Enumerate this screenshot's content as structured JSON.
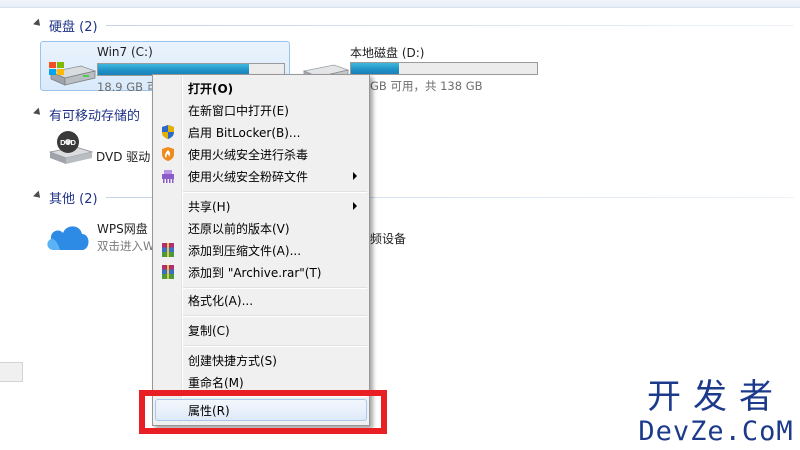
{
  "sections": {
    "hard_disks": {
      "title": "硬盘 (2)"
    },
    "removable": {
      "title": "有可移动存储的"
    },
    "other": {
      "title": "其他 (2)"
    }
  },
  "drives": {
    "c": {
      "name": "Win7 (C:)",
      "free_text": "18.9 GB 可",
      "used_fraction": 0.81
    },
    "d": {
      "name": "本地磁盘 (D:)",
      "free_text": "GB 可用，共 138 GB",
      "used_fraction": 0.26
    }
  },
  "dvd": {
    "name": "DVD 驱动",
    "badge": "DVD"
  },
  "wps": {
    "name": "WPS网盘",
    "sub": "双击进入W"
  },
  "video_device": {
    "name": "频设备"
  },
  "context_menu": {
    "open": "打开(O)",
    "open_new_window": "在新窗口中打开(E)",
    "bitlocker": "启用 BitLocker(B)...",
    "huorong_scan": "使用火绒安全进行杀毒",
    "huorong_shred": "使用火绒安全粉碎文件",
    "share": "共享(H)",
    "restore_previous": "还原以前的版本(V)",
    "add_to_archive": "添加到压缩文件(A)...",
    "add_to_archive_rar": "添加到 \"Archive.rar\"(T)",
    "format": "格式化(A)...",
    "copy": "复制(C)",
    "create_shortcut": "创建快捷方式(S)",
    "rename": "重命名(M)",
    "properties": "属性(R)"
  },
  "watermark": {
    "cn": "开发者",
    "en": "DevZe.CoM"
  },
  "colors": {
    "highlight_box": "#e81f23",
    "header_text": "#1e3287",
    "watermark": "#1c3a8c",
    "drive_bar_fill": "#1e90c6"
  }
}
